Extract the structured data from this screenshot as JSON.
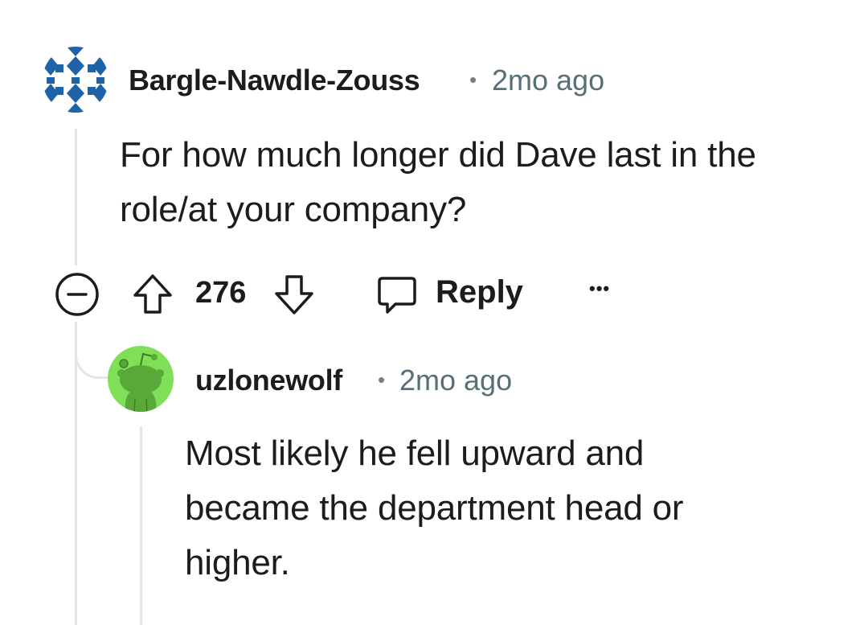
{
  "comments": [
    {
      "username": "Bargle-Nawdle-Zouss",
      "separator": "•",
      "age": "2mo ago",
      "lines": [
        "For how much longer did Dave last in the",
        "role/at your company?"
      ],
      "votes": "276",
      "reply_label": "Reply",
      "more": "•••",
      "avatar_colors": {
        "primary": "#1e62a8",
        "background": "#ffffff"
      }
    },
    {
      "username": "uzlonewolf",
      "separator": "•",
      "age": "2mo ago",
      "lines": [
        "Most likely he fell upward and",
        "became the department head or",
        "higher."
      ],
      "avatar_colors": {
        "primary": "#58a83a",
        "background": "#7fe057"
      }
    }
  ],
  "colors": {
    "text": "#1c1c1c",
    "meta": "#576f76",
    "thread": "#e5e5e5"
  }
}
